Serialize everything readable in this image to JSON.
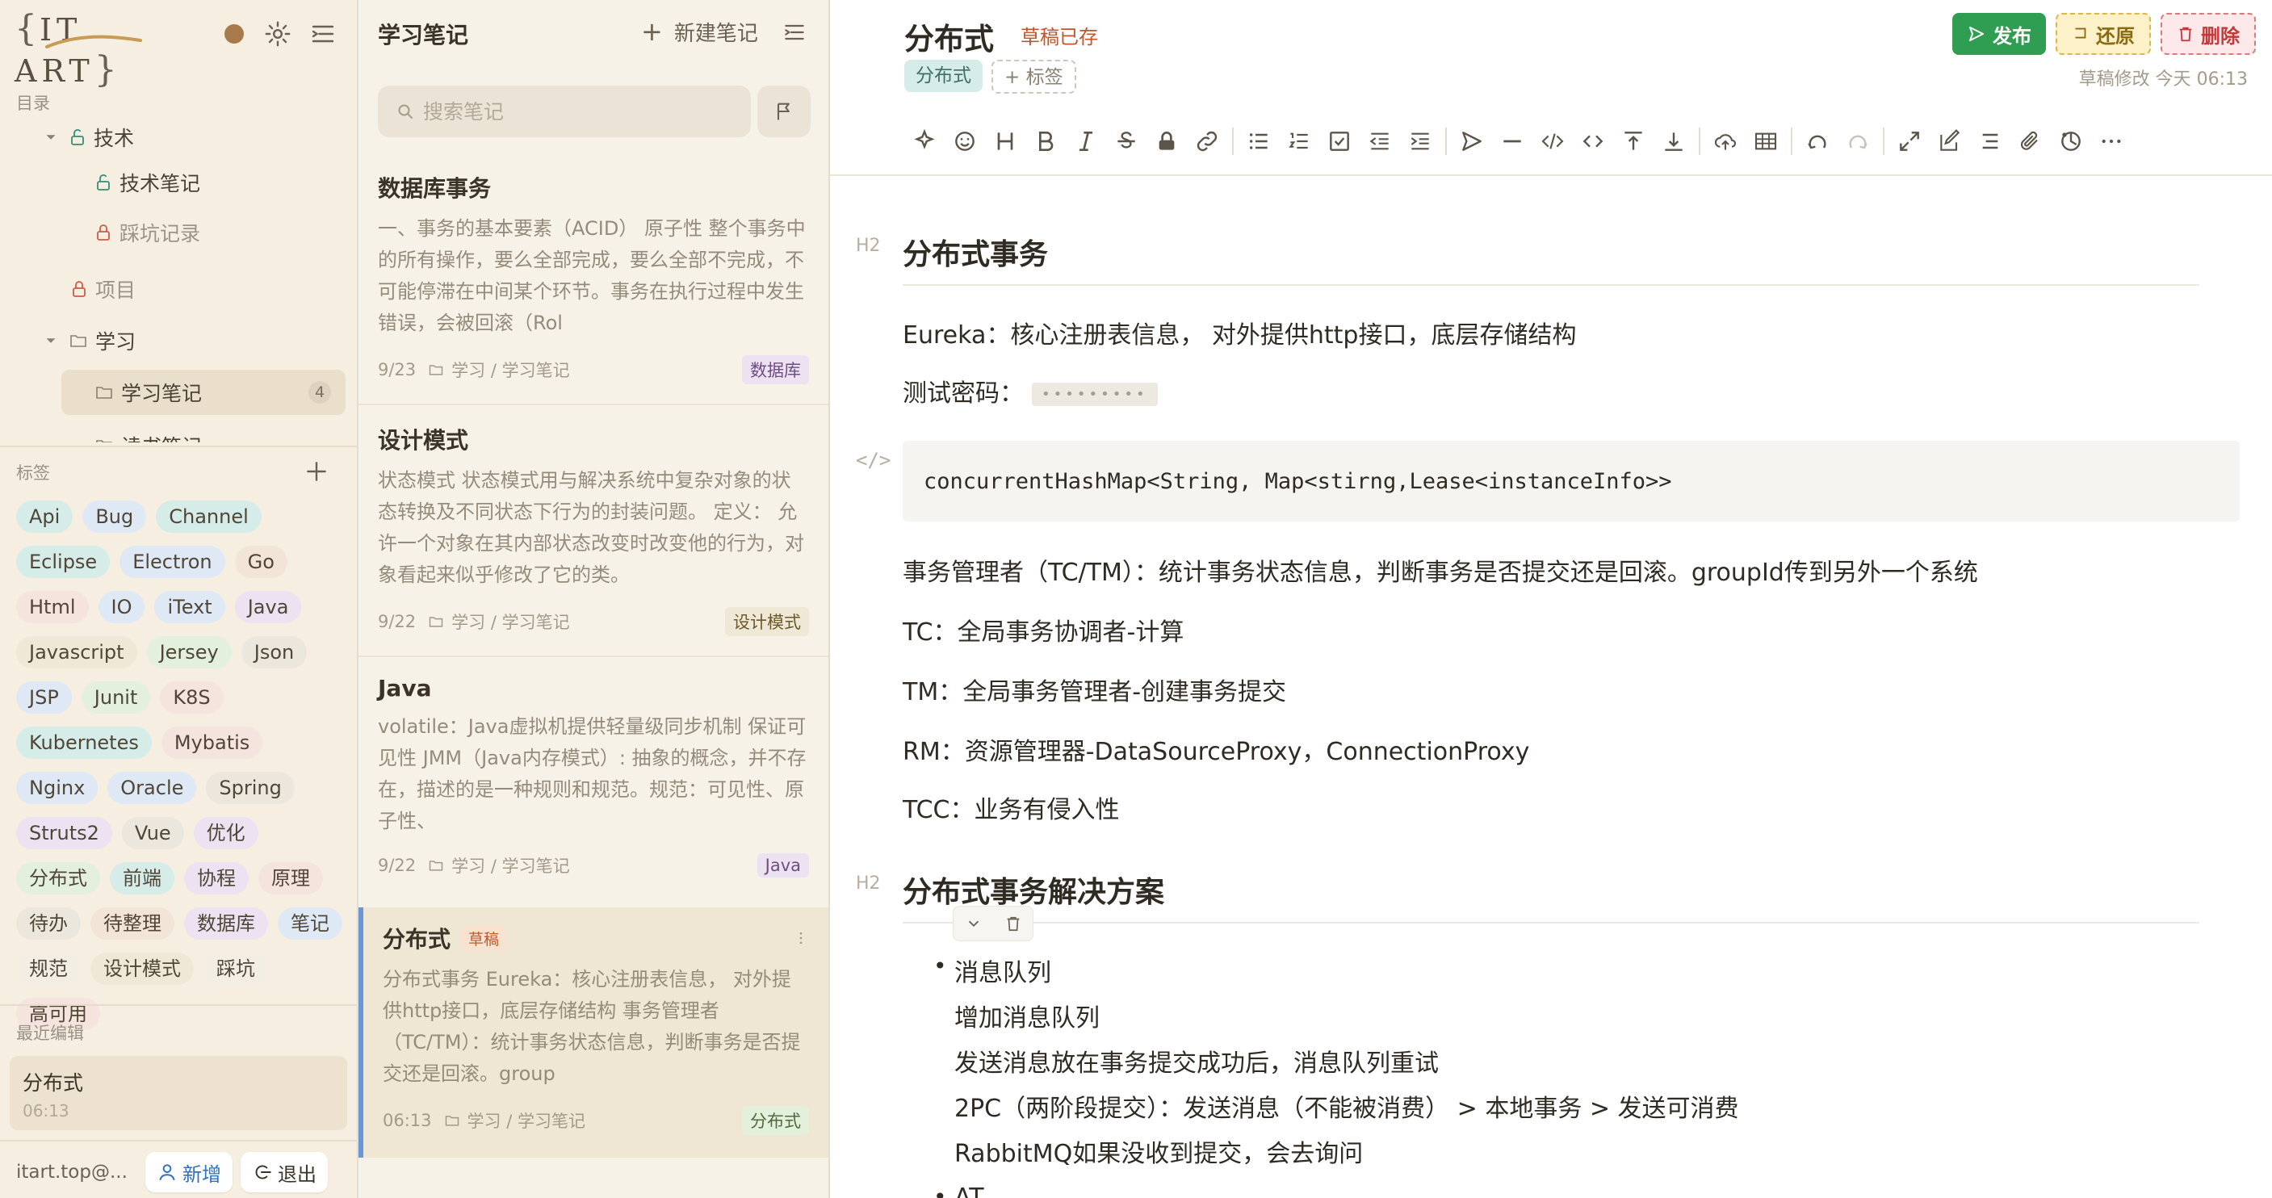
{
  "app": {
    "logo_text": "IT ART"
  },
  "sidebar": {
    "directory_title": "目录",
    "tree": [
      {
        "label": "技术",
        "type": "folder-open",
        "locked": true
      },
      {
        "label": "技术笔记",
        "type": "notebook",
        "locked": true
      },
      {
        "label": "踩坑记录",
        "type": "notebook",
        "locked": true,
        "muted": true
      },
      {
        "label": "项目",
        "type": "notebook",
        "locked": true,
        "muted": true
      },
      {
        "label": "学习",
        "type": "folder-open"
      },
      {
        "label": "学习笔记",
        "type": "notebook",
        "count": "4",
        "active": true
      },
      {
        "label": "读书笔记",
        "type": "notebook"
      }
    ],
    "tags_title": "标签",
    "tags": [
      {
        "label": "Api",
        "color": "#d6ece8"
      },
      {
        "label": "Bug",
        "color": "#dfe9f6"
      },
      {
        "label": "Channel",
        "color": "#d6ece8"
      },
      {
        "label": "Eclipse",
        "color": "#d6ece8"
      },
      {
        "label": "Electron",
        "color": "#dfe9f6"
      },
      {
        "label": "Go",
        "color": "#f3e4d8"
      },
      {
        "label": "Html",
        "color": "#f5e3dd"
      },
      {
        "label": "IO",
        "color": "#dfe9f6"
      },
      {
        "label": "iText",
        "color": "#dfe9f6"
      },
      {
        "label": "Java",
        "color": "#ece2f2"
      },
      {
        "label": "Javascript",
        "color": "#efe8d6"
      },
      {
        "label": "Jersey",
        "color": "#e2f0dc"
      },
      {
        "label": "Json",
        "color": "#ece7dc"
      },
      {
        "label": "JSP",
        "color": "#dfe9f6"
      },
      {
        "label": "Junit",
        "color": "#e2f0dc"
      },
      {
        "label": "K8S",
        "color": "#f5e3dd"
      },
      {
        "label": "Kubernetes",
        "color": "#d6ece8"
      },
      {
        "label": "Mybatis",
        "color": "#f5e3dd"
      },
      {
        "label": "Nginx",
        "color": "#dfe9f6"
      },
      {
        "label": "Oracle",
        "color": "#dfe9f6"
      },
      {
        "label": "Spring",
        "color": "#ece7dc"
      },
      {
        "label": "Struts2",
        "color": "#ece2f2"
      },
      {
        "label": "Vue",
        "color": "#ece7dc"
      },
      {
        "label": "优化",
        "color": "#ece2f2"
      },
      {
        "label": "分布式",
        "color": "#e2f0dc"
      },
      {
        "label": "前端",
        "color": "#d6ece8"
      },
      {
        "label": "协程",
        "color": "#ece2f2"
      },
      {
        "label": "原理",
        "color": "#f5e3dd"
      },
      {
        "label": "待办",
        "color": "#ece7dc"
      },
      {
        "label": "待整理",
        "color": "#f3e4d8"
      },
      {
        "label": "数据库",
        "color": "#ece2f2"
      },
      {
        "label": "笔记",
        "color": "#dfe9f6"
      },
      {
        "label": "规范",
        "color": "#f3eee4"
      },
      {
        "label": "设计模式",
        "color": "#efe8d6"
      },
      {
        "label": "踩坑",
        "color": "#f3eee4"
      },
      {
        "label": "高可用",
        "color": "#f5e3dd"
      }
    ],
    "recent_title": "最近编辑",
    "recent": {
      "title": "分布式",
      "time": "06:13"
    },
    "footer": {
      "email": "itart.top@...",
      "new_label": "新增",
      "logout_label": "退出"
    }
  },
  "notelist": {
    "title": "学习笔记",
    "new_note_label": "新建笔记",
    "search_placeholder": "搜索笔记",
    "notes": [
      {
        "title": "数据库事务",
        "body": "一、事务的基本要素（ACID） 原子性 整个事务中的所有操作，要么全部完成，要么全部不完成，不可能停滞在中间某个环节。事务在执行过程中发生错误，会被回滚（Rol",
        "date": "9/23",
        "path": "学习 / 学习笔记",
        "tag": "数据库",
        "tag_color": "#ece2f2"
      },
      {
        "title": "设计模式",
        "body": "状态模式 状态模式用与解决系统中复杂对象的状态转换及不同状态下行为的封装问题。 定义： 允许一个对象在其内部状态改变时改变他的行为，对象看起来似乎修改了它的类。",
        "date": "9/22",
        "path": "学习 / 学习笔记",
        "tag": "设计模式",
        "tag_color": "#efe8d6"
      },
      {
        "title": "Java",
        "body": "volatile：Java虚拟机提供轻量级同步机制 保证可见性 JMM（Java内存模式）: 抽象的概念，并不存在，描述的是一种规则和规范。规范：可见性、原子性、",
        "date": "9/22",
        "path": "学习 / 学习笔记",
        "tag": "Java",
        "tag_color": "#ece2f2"
      },
      {
        "title": "分布式",
        "draft": "草稿",
        "body": "分布式事务 Eureka：核心注册表信息， 对外提供http接口，底层存储结构 事务管理者（TC/TM）：统计事务状态信息，判断事务是否提交还是回滚。group",
        "date": "06:13",
        "path": "学习 / 学习笔记",
        "tag": "分布式",
        "tag_color": "#e2f0dc",
        "selected": true
      }
    ]
  },
  "editor": {
    "title": "分布式",
    "status": "草稿已存",
    "tag": "分布式",
    "add_tag_label": "+ 标签",
    "publish_label": "发布",
    "restore_label": "还原",
    "delete_label": "删除",
    "modified": "草稿修改  今天 06:13",
    "toolbar": [
      "sparkle-icon",
      "emoji-icon",
      "heading-icon",
      "bold-icon",
      "italic-icon",
      "strike-icon",
      "lock-icon",
      "link-icon",
      "|",
      "bullet-list-icon",
      "ordered-list-icon",
      "check-list-icon",
      "outdent-icon",
      "indent-icon",
      "|",
      "quote-icon",
      "hr-icon",
      "code-icon",
      "inline-code-icon",
      "insert-before-icon",
      "insert-after-icon",
      "|",
      "upload-icon",
      "table-icon",
      "|",
      "undo-icon",
      "redo-icon",
      "|",
      "fullscreen-icon",
      "edit-mode-icon",
      "outline-icon",
      "attachment-icon",
      "devtools-icon",
      "more-icon"
    ],
    "content": {
      "h2_mark": "H2",
      "code_mark": "</>",
      "h2_1": "分布式事务",
      "p_eureka": "Eureka：核心注册表信息， 对外提供http接口，底层存储结构",
      "p_pwd_label": "测试密码：",
      "p_pwd_value": "•••••••••",
      "code": "concurrentHashMap<String, Map<stirng,Lease<instanceInfo>>",
      "p_tm": "事务管理者（TC/TM）：统计事务状态信息，判断事务是否提交还是回滚。groupId传到另外一个系统",
      "p_tc": "TC：全局事务协调者-计算",
      "p_tm2": "TM：全局事务管理者-创建事务提交",
      "p_rm": "RM：资源管理器-DataSourceProxy，ConnectionProxy",
      "p_tcc": "TCC：业务有侵入性",
      "h2_2": "分布式事务解决方案",
      "li_1": "消息队列",
      "li_1_lines": [
        "增加消息队列",
        "发送消息放在事务提交成功后，消息队列重试",
        "2PC（两阶段提交）：发送消息（不能被消费） > 本地事务 > 发送可消费",
        "RabbitMQ如果没收到提交，会去询问"
      ],
      "li_2": "AT"
    }
  }
}
